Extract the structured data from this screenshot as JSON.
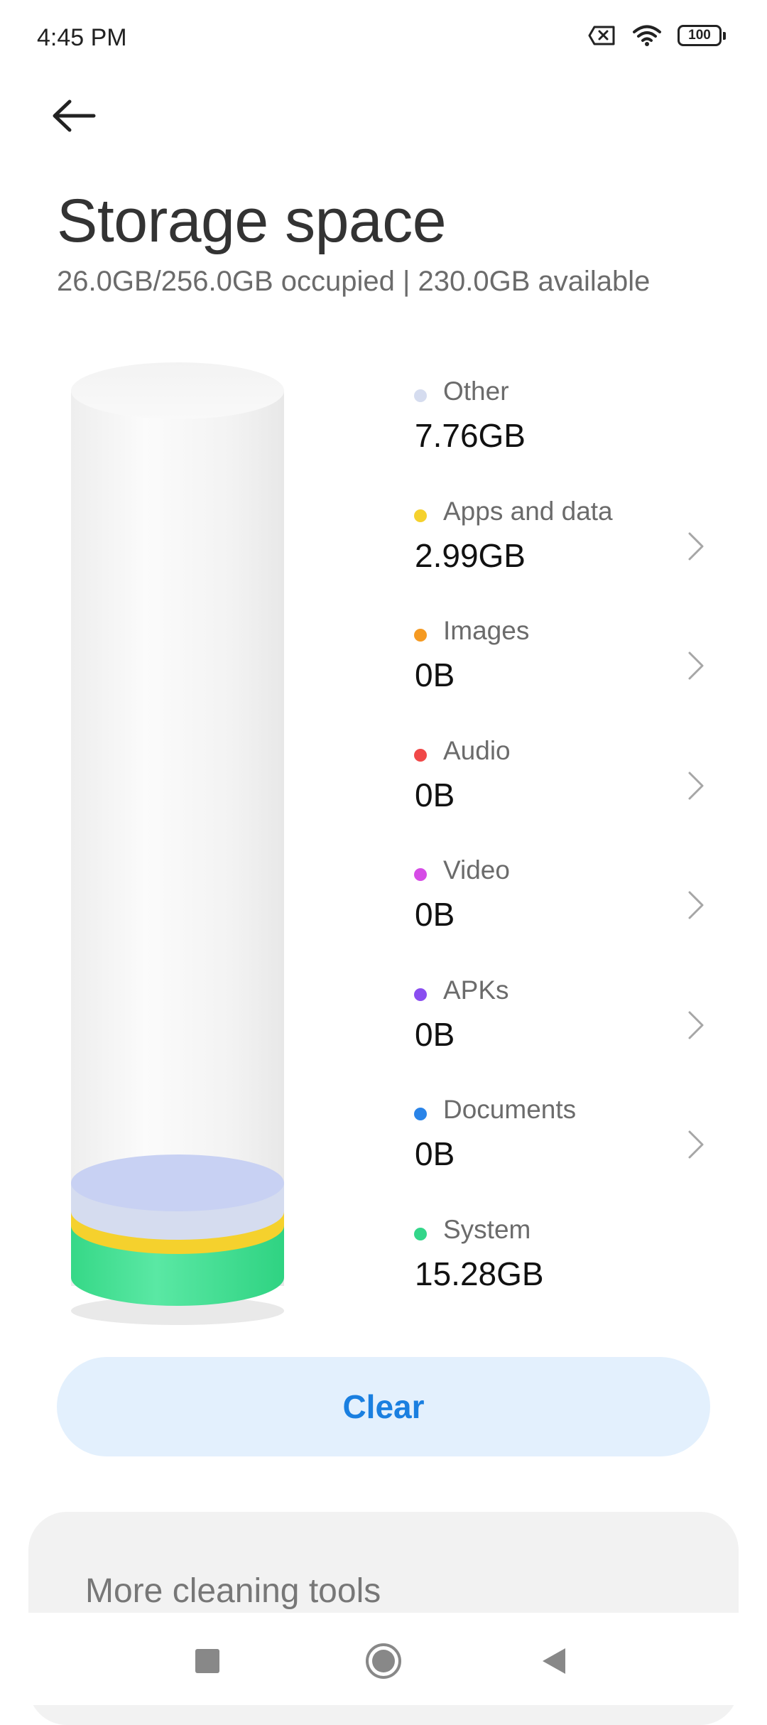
{
  "status_bar": {
    "time": "4:45 PM",
    "battery": "100",
    "icons": [
      "sim-off-icon",
      "wifi-icon",
      "battery-icon"
    ]
  },
  "header": {
    "back_icon": "arrow-left-icon",
    "title": "Storage space",
    "subtitle": "26.0GB/256.0GB occupied | 230.0GB available"
  },
  "storage": {
    "total_gb": 256.0,
    "used_gb": 26.0,
    "categories": [
      {
        "label": "Other",
        "value": "7.76GB",
        "color": "#d5dcef",
        "has_chevron": false
      },
      {
        "label": "Apps and data",
        "value": "2.99GB",
        "color": "#f5d12d",
        "has_chevron": true
      },
      {
        "label": "Images",
        "value": "0B",
        "color": "#f59a22",
        "has_chevron": true
      },
      {
        "label": "Audio",
        "value": "0B",
        "color": "#f04848",
        "has_chevron": true
      },
      {
        "label": "Video",
        "value": "0B",
        "color": "#d64ce6",
        "has_chevron": true
      },
      {
        "label": "APKs",
        "value": "0B",
        "color": "#8a4ef0",
        "has_chevron": true
      },
      {
        "label": "Documents",
        "value": "0B",
        "color": "#2a84e8",
        "has_chevron": true
      },
      {
        "label": "System",
        "value": "15.28GB",
        "color": "#33d68a",
        "has_chevron": false
      }
    ]
  },
  "actions": {
    "clear_label": "Clear"
  },
  "tools": {
    "title": "More cleaning tools"
  },
  "nav": {
    "icons": [
      "recents-icon",
      "home-icon",
      "back-icon"
    ]
  },
  "colors": {
    "accent": "#1a7fe0",
    "clear_button_bg": "#e3f0fd"
  }
}
